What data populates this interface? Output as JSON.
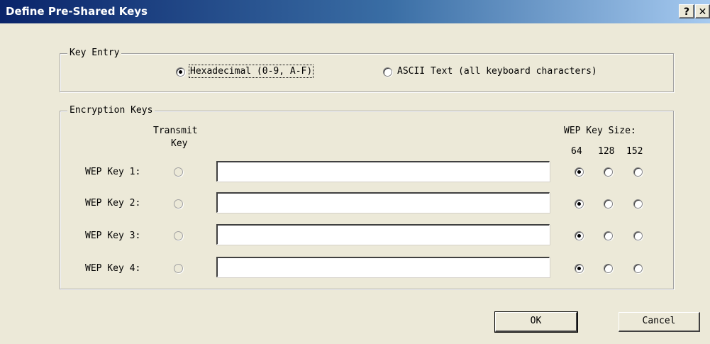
{
  "window": {
    "title": "Define Pre-Shared Keys",
    "help_label": "?",
    "close_label": "✕"
  },
  "key_entry": {
    "legend": "Key Entry",
    "options": [
      {
        "label": "Hexadecimal (0-9, A-F)",
        "selected": true
      },
      {
        "label": "ASCII Text (all keyboard characters)",
        "selected": false
      }
    ]
  },
  "encryption_keys": {
    "legend": "Encryption Keys",
    "transmit_header_line1": "Transmit",
    "transmit_header_line2": "Key",
    "size_header": "WEP Key Size:",
    "sizes": [
      "64",
      "128",
      "152"
    ],
    "keys": [
      {
        "label": "WEP Key 1:",
        "value": "",
        "transmit": false,
        "size": "64"
      },
      {
        "label": "WEP Key 2:",
        "value": "",
        "transmit": false,
        "size": "64"
      },
      {
        "label": "WEP Key 3:",
        "value": "",
        "transmit": false,
        "size": "64"
      },
      {
        "label": "WEP Key 4:",
        "value": "",
        "transmit": false,
        "size": "64"
      }
    ]
  },
  "buttons": {
    "ok": "OK",
    "cancel": "Cancel"
  }
}
